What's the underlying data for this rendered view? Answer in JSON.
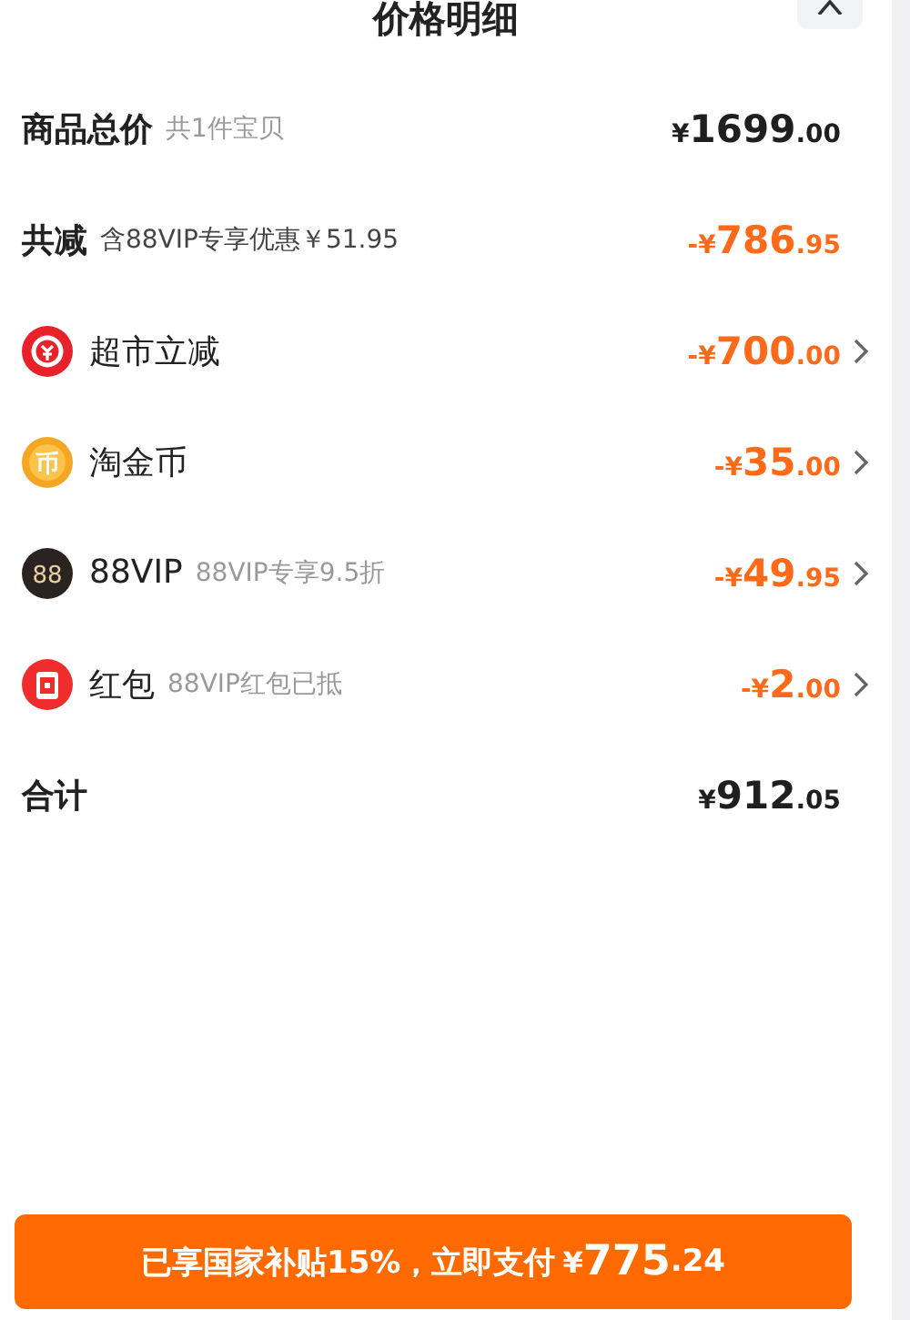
{
  "header": {
    "title": "价格明细"
  },
  "rows": [
    {
      "kind": "total",
      "label": "商品总价",
      "note": "共1件宝贝",
      "price": {
        "prefix": "¥",
        "int": "1699",
        "dec": ".00"
      }
    },
    {
      "kind": "reduction",
      "label": "共减",
      "note": "含88VIP专享优惠￥51.95",
      "price": {
        "prefix": "-¥",
        "int": "786",
        "dec": ".95"
      }
    },
    {
      "kind": "coupon",
      "label": "超市立减",
      "price": {
        "prefix": "-¥",
        "int": "700",
        "dec": ".00"
      }
    },
    {
      "kind": "coin",
      "icon_text": "币",
      "label": "淘金币",
      "price": {
        "prefix": "-¥",
        "int": "35",
        "dec": ".00"
      }
    },
    {
      "kind": "vip",
      "icon_text": "88",
      "label": "88VIP",
      "note": "88VIP专享9.5折",
      "price": {
        "prefix": "-¥",
        "int": "49",
        "dec": ".95"
      }
    },
    {
      "kind": "packet",
      "label": "红包",
      "note": "88VIP红包已抵",
      "price": {
        "prefix": "-¥",
        "int": "2",
        "dec": ".00"
      }
    },
    {
      "kind": "total",
      "label": "合计",
      "price": {
        "prefix": "¥",
        "int": "912",
        "dec": ".05"
      }
    }
  ],
  "pay_button": {
    "text": "已享国家补贴15%，立即支付",
    "prefix": "¥",
    "int": "775",
    "dec": ".24"
  }
}
